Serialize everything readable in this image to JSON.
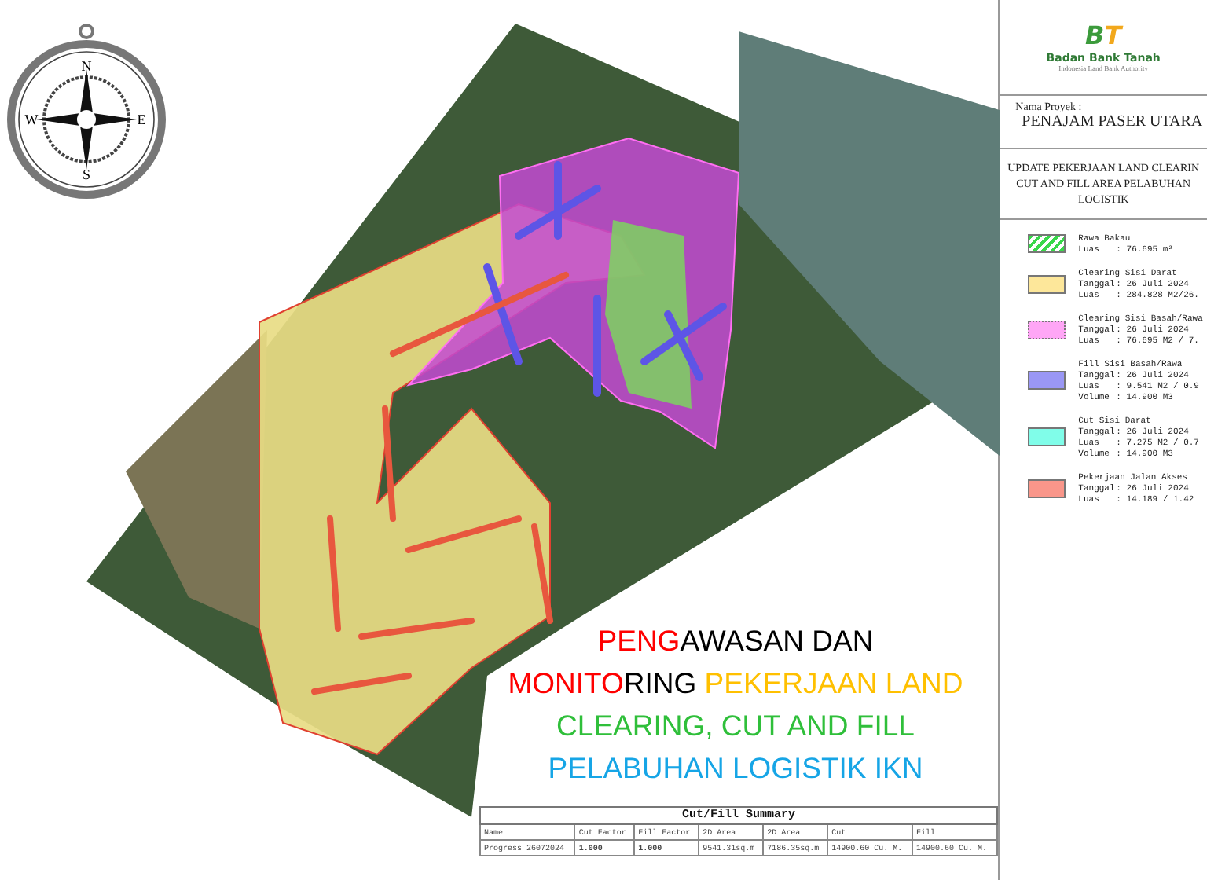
{
  "compass": {
    "north": "N",
    "east": "E",
    "south": "S",
    "west": "W"
  },
  "overlay_title": {
    "lines": [
      [
        {
          "text": "PENG",
          "color": "#ff0000"
        },
        {
          "text": "AWASAN DAN",
          "color": "#000000"
        }
      ],
      [
        {
          "text": "MONITO",
          "color": "#ff0000"
        },
        {
          "text": "RING ",
          "color": "#000000"
        },
        {
          "text": "PEKERJAAN LAND",
          "color": "#ffc000"
        }
      ],
      [
        {
          "text": "CLEARING, CUT AND FILL",
          "color": "#2fbf3a"
        }
      ],
      [
        {
          "text": "PELABUHAN LOGISTIK IKN",
          "color": "#16a5e6"
        }
      ]
    ]
  },
  "summary_table": {
    "title": "Cut/Fill Summary",
    "columns": [
      "Name",
      "Cut Factor",
      "Fill Factor",
      "2D Area",
      "2D Area",
      "Cut",
      "Fill"
    ],
    "rows": [
      [
        "Progress 26072024",
        "1.000",
        "1.000",
        "9541.31sq.m",
        "7186.35sq.m",
        "14900.60 Cu. M.",
        "14900.60 Cu. M."
      ]
    ]
  },
  "side_panel": {
    "logo": {
      "mark_left": "B",
      "mark_right": "T",
      "name": "Badan Bank Tanah",
      "tagline": "Indonesia Land Bank Authority"
    },
    "project_label": "Nama Proyek :",
    "project_name": "PENAJAM PASER UTARA",
    "description": [
      "UPDATE PEKERJAAN LAND CLEARIN",
      "CUT AND FILL AREA PELABUHAN",
      "LOGISTIK"
    ],
    "legend": [
      {
        "kind": "hatch",
        "color": "#38d84a",
        "title": "Rawa Bakau",
        "rows": [
          {
            "label": "Luas",
            "value": ": 76.695 m²"
          }
        ]
      },
      {
        "kind": "solid",
        "color": "#fde79a",
        "title": "Clearing Sisi Darat",
        "rows": [
          {
            "label": "Tanggal",
            "value": ": 26 Juli 2024"
          },
          {
            "label": "Luas",
            "value": ": 284.828 M2/26."
          }
        ]
      },
      {
        "kind": "dotted",
        "color": "#ffa6f6",
        "title": "Clearing Sisi Basah/Rawa",
        "rows": [
          {
            "label": "Tanggal",
            "value": ": 26 Juli 2024"
          },
          {
            "label": "Luas",
            "value": ": 76.695 M2 / 7."
          }
        ]
      },
      {
        "kind": "solid",
        "color": "#9a97f5",
        "title": "Fill Sisi Basah/Rawa",
        "rows": [
          {
            "label": "Tanggal",
            "value": ": 26 Juli 2024"
          },
          {
            "label": "Luas",
            "value": ": 9.541 M2 / 0.9"
          },
          {
            "label": "Volume",
            "value": ": 14.900 M3"
          }
        ]
      },
      {
        "kind": "solid",
        "color": "#80fde9",
        "title": "Cut Sisi Darat",
        "rows": [
          {
            "label": "Tanggal",
            "value": ": 26 Juli 2024"
          },
          {
            "label": "Luas",
            "value": ": 7.275 M2 / 0.7"
          },
          {
            "label": "Volume",
            "value": ": 14.900 M3"
          }
        ]
      },
      {
        "kind": "solid",
        "color": "#f9968a",
        "title": "Pekerjaan Jalan Akses",
        "rows": [
          {
            "label": "Tanggal",
            "value": ": 26 Juli 2024"
          },
          {
            "label": "Luas",
            "value": ": 14.189 / 1.42"
          }
        ]
      }
    ]
  }
}
